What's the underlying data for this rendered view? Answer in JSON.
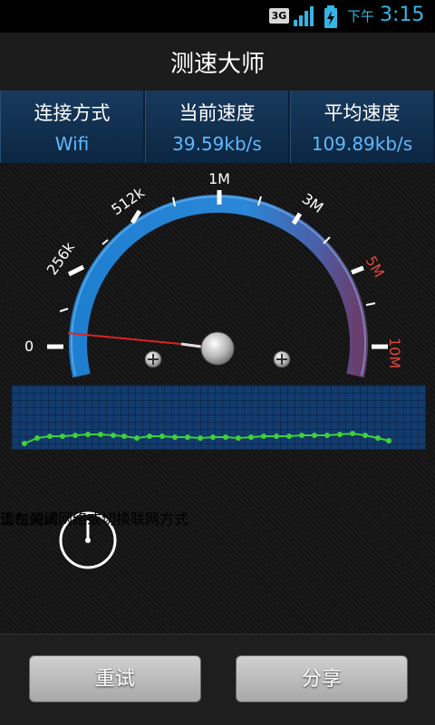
{
  "status_bar": {
    "network": "3G",
    "ampm": "下午",
    "time": "3:15"
  },
  "app": {
    "title": "测速大师"
  },
  "info": [
    {
      "label": "连接方式",
      "value": "Wifi"
    },
    {
      "label": "当前速度",
      "value": "39.59kb/s"
    },
    {
      "label": "平均速度",
      "value": "109.89kb/s"
    }
  ],
  "gauge": {
    "labels": [
      "0",
      "256k",
      "512k",
      "1M",
      "3M",
      "5M",
      "10M"
    ],
    "needle_value_label": "0",
    "red_labels": [
      "5M",
      "10M"
    ],
    "arc_color": "#1e7fd0",
    "red_color": "#e0453c"
  },
  "test": {
    "status": "正在测试...",
    "hint": "请勿关闭网络或切换联网方式"
  },
  "buttons": {
    "retry": "重试",
    "share": "分享"
  }
}
